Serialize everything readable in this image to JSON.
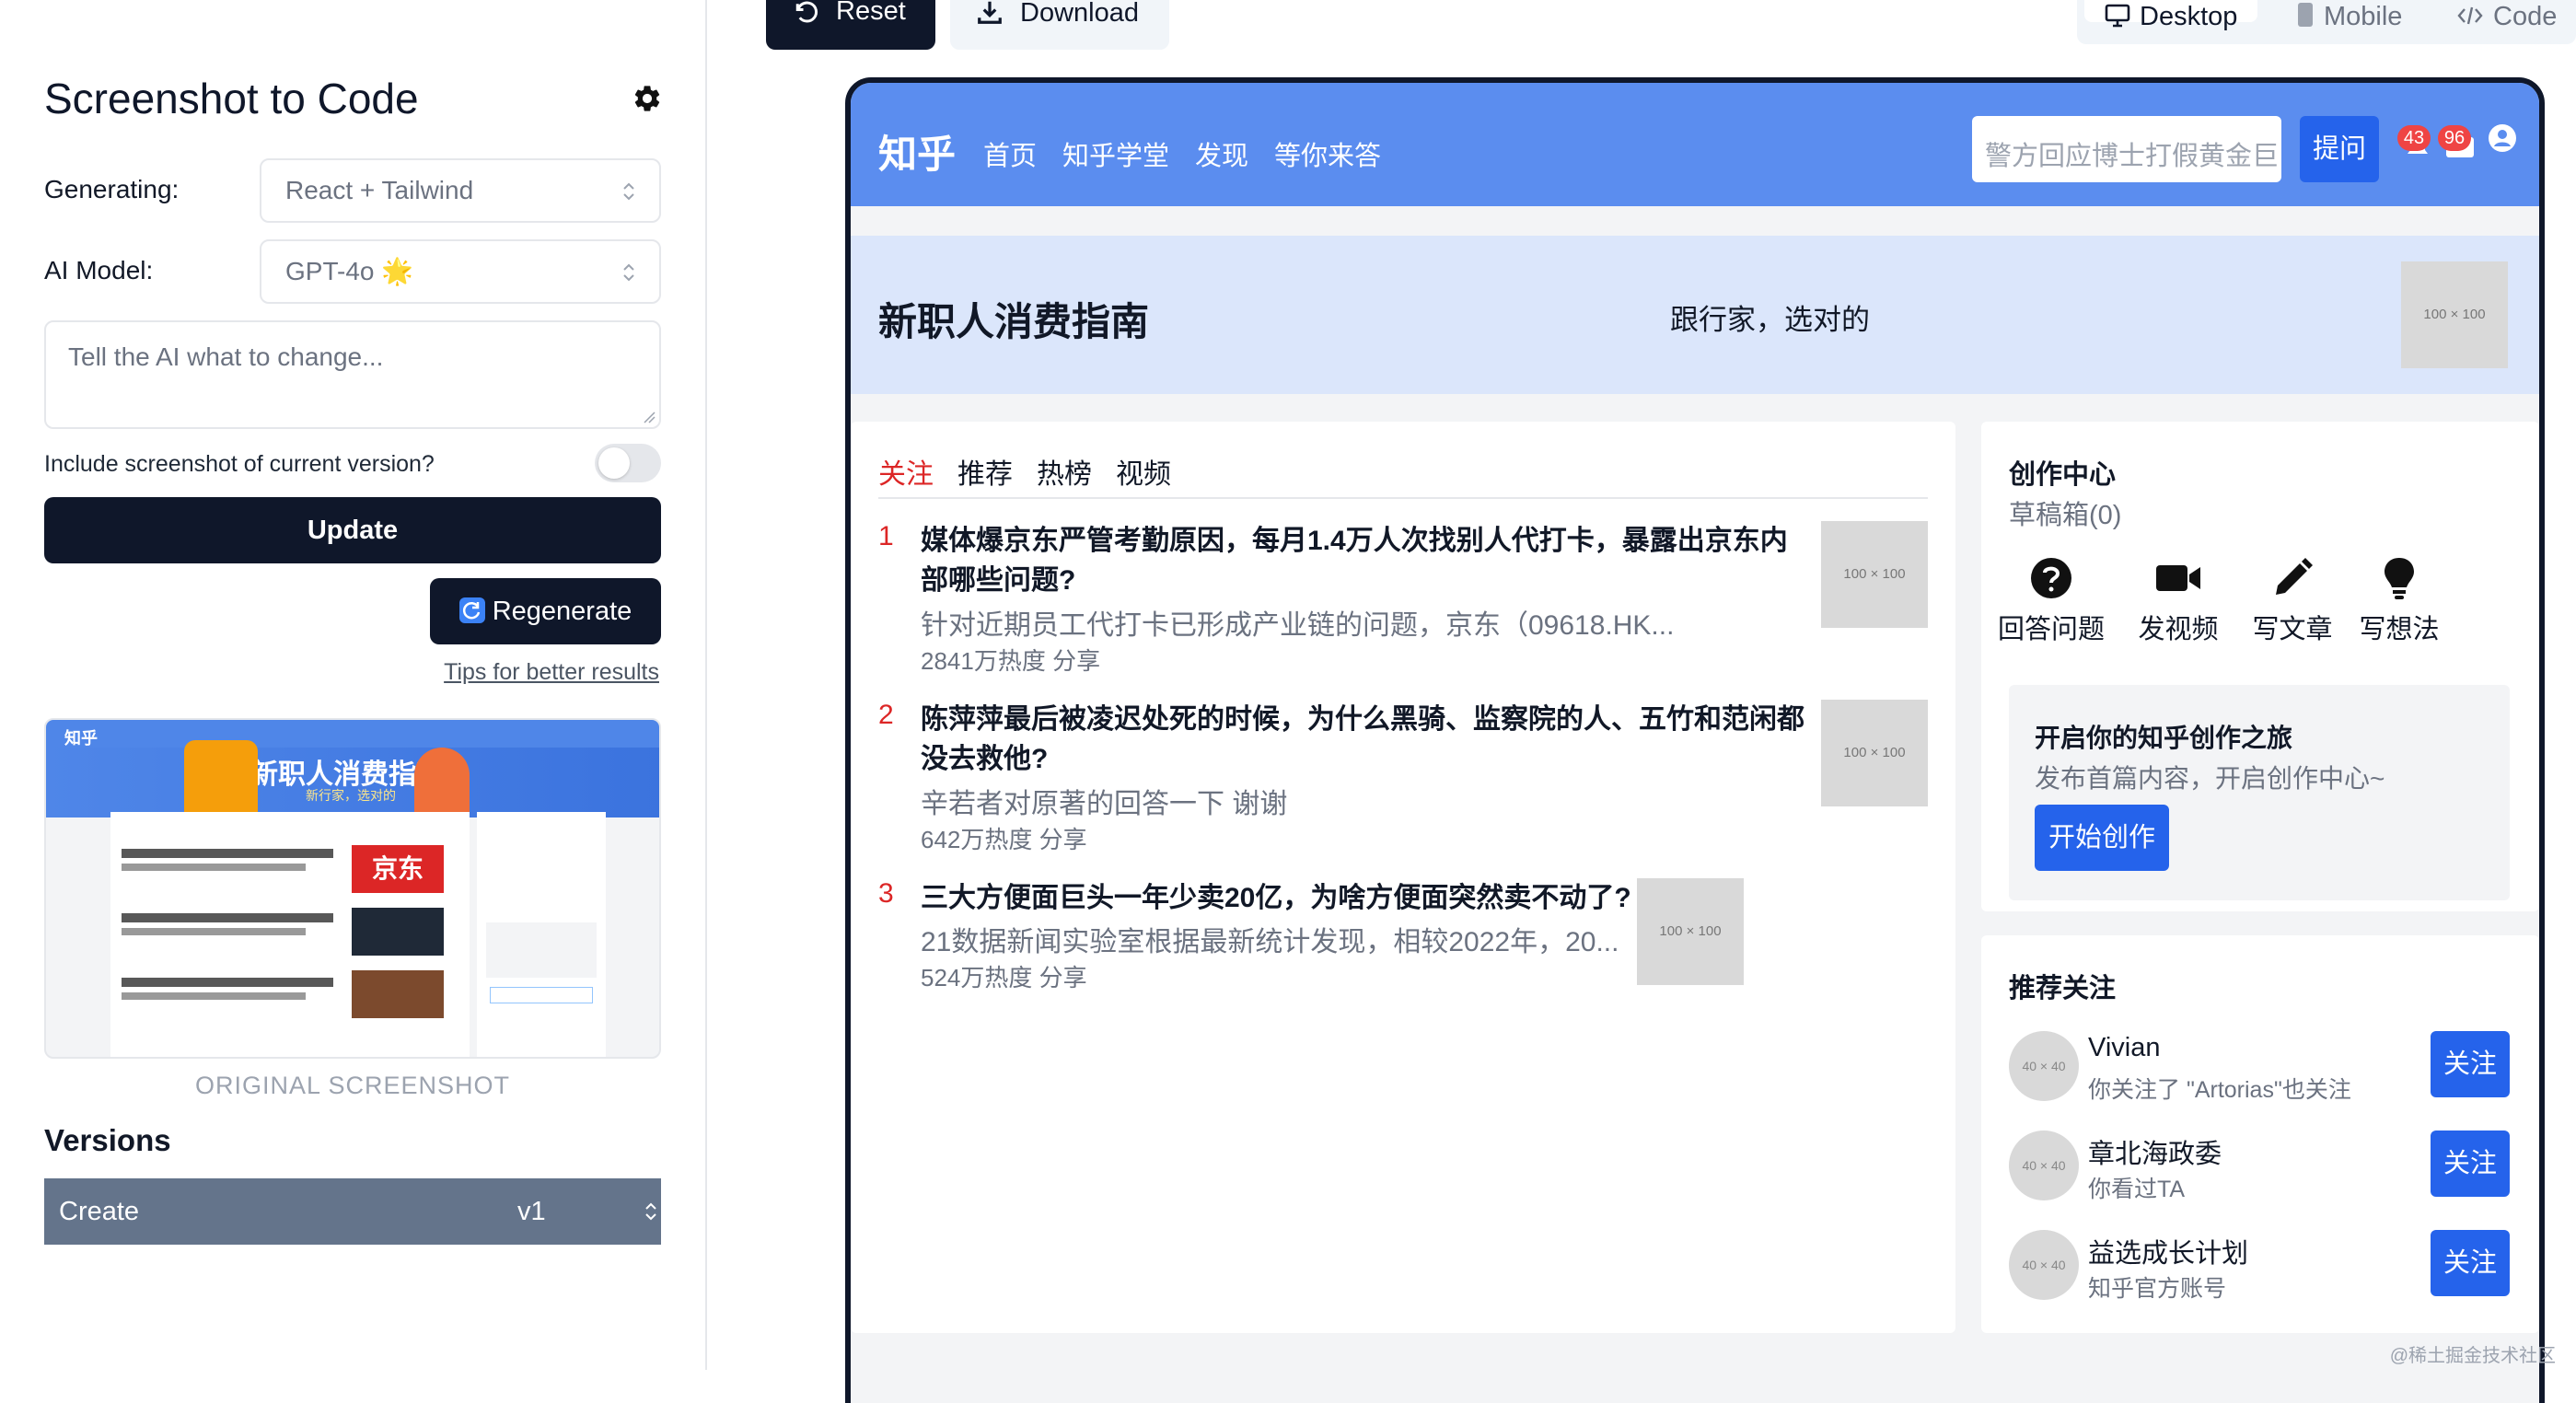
{
  "sidebar": {
    "title": "Screenshot to Code",
    "generating_label": "Generating:",
    "generating_value": "React + Tailwind",
    "model_label": "AI Model:",
    "model_value": "GPT-4o 🌟",
    "change_placeholder": "Tell the AI what to change...",
    "include_label": "Include screenshot of current version?",
    "include_toggle_on": false,
    "update_label": "Update",
    "regenerate_label": "Regenerate",
    "tips_label": "Tips for better results",
    "original_caption": "ORIGINAL SCREENSHOT",
    "versions_title": "Versions",
    "versions": [
      {
        "name": "Create",
        "version": "v1"
      }
    ]
  },
  "topbar": {
    "reset_label": "Reset",
    "download_label": "Download",
    "tabs": [
      "Desktop",
      "Mobile",
      "Code"
    ],
    "active_tab": "Desktop"
  },
  "thumbnail": {
    "logo": "知乎",
    "banner_title": "新职人消费指南",
    "banner_sub": "新行家，选对的",
    "jd_label": "京东"
  },
  "preview": {
    "logo": "知乎",
    "nav": [
      "首页",
      "知乎学堂",
      "发现",
      "等你来答"
    ],
    "search_placeholder": "警方回应博士打假黄金巨",
    "ask_label": "提问",
    "badges": [
      "43",
      "96"
    ],
    "banner": {
      "title": "新职人消费指南",
      "slogan": "跟行家，选对的",
      "image_placeholder": "100 × 100"
    },
    "feed_tabs": [
      "关注",
      "推荐",
      "热榜",
      "视频"
    ],
    "active_feed_tab": "关注",
    "hot_list": [
      {
        "rank": "1",
        "title": "媒体爆京东严管考勤原因，每月1.4万人次找别人代打卡，暴露出京东内部哪些问题?",
        "excerpt": "针对近期员工代打卡已形成产业链的问题，京东（09618.HK...",
        "meta": "2841万热度  分享",
        "thumb": "100 × 100"
      },
      {
        "rank": "2",
        "title": "陈萍萍最后被凌迟处死的时候，为什么黑骑、监察院的人、五竹和范闲都没去救他?",
        "excerpt": "辛若者对原著的回答一下 谢谢",
        "meta": "642万热度  分享",
        "thumb": "100 × 100"
      },
      {
        "rank": "3",
        "title": "三大方便面巨头一年少卖20亿，为啥方便面突然卖不动了?",
        "excerpt": "21数据新闻实验室根据最新统计发现，相较2022年，20...",
        "meta": "524万热度  分享",
        "thumb": "100 × 100"
      }
    ],
    "creator": {
      "title": "创作中心",
      "drafts": "草稿箱(0)",
      "actions": [
        {
          "icon": "question-icon",
          "label": "回答问题"
        },
        {
          "icon": "video-icon",
          "label": "发视频"
        },
        {
          "icon": "pencil-icon",
          "label": "写文章"
        },
        {
          "icon": "bulb-icon",
          "label": "写想法"
        }
      ],
      "promo_title": "开启你的知乎创作之旅",
      "promo_sub": "发布首篇内容，开启创作中心~",
      "promo_button": "开始创作"
    },
    "recommend": {
      "title": "推荐关注",
      "users": [
        {
          "name": "Vivian",
          "desc": "你关注了 \"Artorias\"也关注",
          "avatar": "40 × 40",
          "button": "关注"
        },
        {
          "name": "章北海政委",
          "desc": "你看过TA",
          "avatar": "40 × 40",
          "button": "关注"
        },
        {
          "name": "益选成长计划",
          "desc": "知乎官方账号",
          "avatar": "40 × 40",
          "button": "关注"
        }
      ]
    }
  },
  "watermark": "@稀土掘金技术社区",
  "colors": {
    "dark": "#0f172a",
    "zhihu_header": "#5b8def",
    "zhihu_blue": "#2563eb",
    "banner_bg": "#dbe6fb",
    "rank_red": "#dc2626",
    "version_row": "#64748b"
  }
}
